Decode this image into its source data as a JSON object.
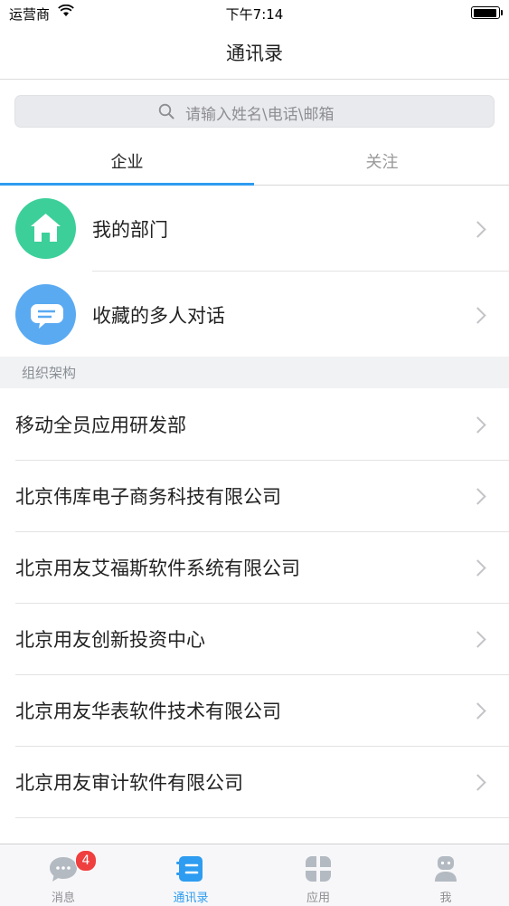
{
  "status_bar": {
    "carrier": "运营商",
    "time": "下午7:14",
    "battery_level": 0.85
  },
  "header": {
    "title": "通讯录"
  },
  "search": {
    "placeholder": "请输入姓名\\电话\\邮箱"
  },
  "tabs": [
    {
      "label": "企业",
      "active": true
    },
    {
      "label": "关注",
      "active": false
    }
  ],
  "features": [
    {
      "label": "我的部门",
      "icon": "home-icon",
      "color": "#3ccf9a"
    },
    {
      "label": "收藏的多人对话",
      "icon": "chat-bubble-icon",
      "color": "#5aaaf2"
    }
  ],
  "section": {
    "title": "组织架构"
  },
  "org_list": [
    "移动全员应用研发部",
    "北京伟库电子商务科技有限公司",
    "北京用友艾福斯软件系统有限公司",
    "北京用友创新投资中心",
    "北京用友华表软件技术有限公司",
    "北京用友审计软件有限公司"
  ],
  "tab_bar": {
    "items": [
      {
        "label": "消息",
        "icon": "message-icon",
        "badge": "4",
        "active": false
      },
      {
        "label": "通讯录",
        "icon": "contacts-icon",
        "active": true
      },
      {
        "label": "应用",
        "icon": "apps-icon",
        "active": false
      },
      {
        "label": "我",
        "icon": "profile-icon",
        "active": false
      }
    ]
  },
  "colors": {
    "accent": "#2e9cf0",
    "badge": "#ef3f3f"
  }
}
